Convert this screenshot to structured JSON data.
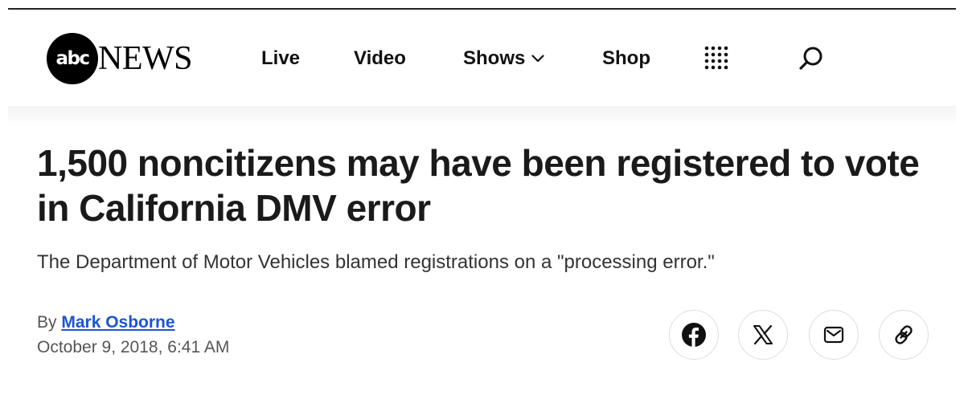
{
  "header": {
    "logo": {
      "circle_text": "abc",
      "word_text": "NEWS"
    },
    "nav": {
      "live_label": "Live",
      "video_label": "Video",
      "shows_label": "Shows",
      "shop_label": "Shop"
    },
    "icons": {
      "shows_dropdown": "chevron-down-icon",
      "more_menu": "grid-icon",
      "search": "search-icon"
    }
  },
  "article": {
    "headline": "1,500 noncitizens may have been registered to vote in California DMV error",
    "subheadline": "The Department of Motor Vehicles blamed registrations on a \"processing error.\"",
    "byline_prefix": "By",
    "author": "Mark Osborne",
    "date": "October 9, 2018, 6:41 AM"
  },
  "share": {
    "icons": [
      "facebook-icon",
      "x-icon",
      "mail-icon",
      "link-icon"
    ]
  },
  "colors": {
    "text": "#1a1a1a",
    "author_link": "#1a55d6",
    "muted": "#555555",
    "logo_black": "#000000"
  }
}
